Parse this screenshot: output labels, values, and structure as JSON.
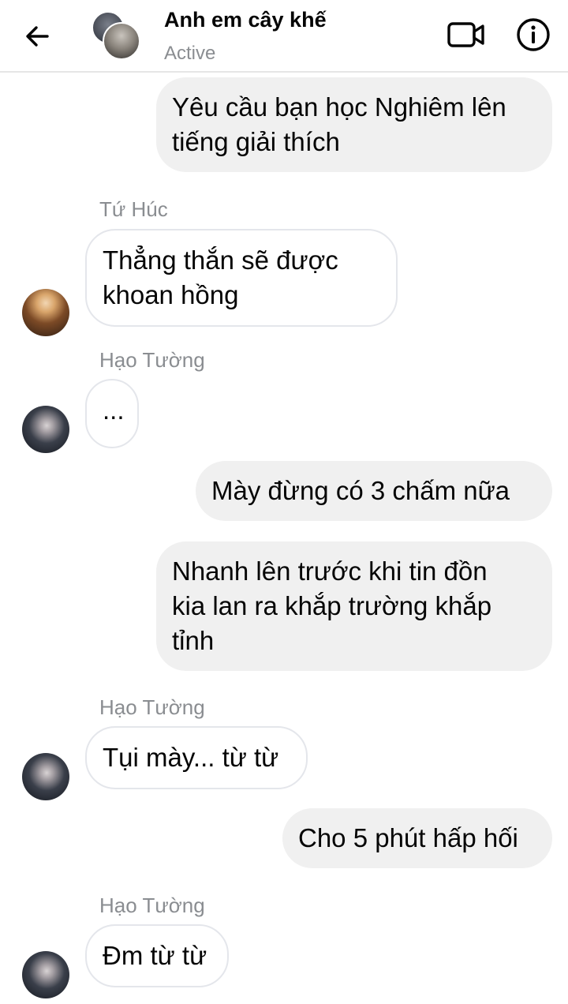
{
  "header": {
    "title": "Anh em cây khế",
    "status": "Active",
    "back_icon": "arrow-left-icon",
    "video_icon": "video-camera-icon",
    "info_icon": "info-icon"
  },
  "colors": {
    "outgoing_bubble": "#f0f0f0",
    "incoming_border": "#e4e6eb",
    "secondary_text": "#8a8d91"
  },
  "messages": [
    {
      "direction": "outgoing",
      "text": "Yêu cầu bạn học Nghiêm lên\ntiếng giải thích"
    },
    {
      "direction": "incoming",
      "sender": "Tứ Húc",
      "text": "Thẳng thắn sẽ được\nkhoan hồng"
    },
    {
      "direction": "incoming",
      "sender": "Hạo Tường",
      "text": "..."
    },
    {
      "direction": "outgoing",
      "text": "Mày đừng có 3 chấm nữa"
    },
    {
      "direction": "outgoing",
      "text": "Nhanh lên trước khi tin đồn\nkia lan ra khắp trường khắp\ntỉnh"
    },
    {
      "direction": "incoming",
      "sender": "Hạo Tường",
      "text": "Tụi mày... từ từ"
    },
    {
      "direction": "outgoing",
      "text": "Cho 5 phút hấp hối"
    },
    {
      "direction": "incoming",
      "sender": "Hạo Tường",
      "text": "Đm từ từ"
    }
  ]
}
